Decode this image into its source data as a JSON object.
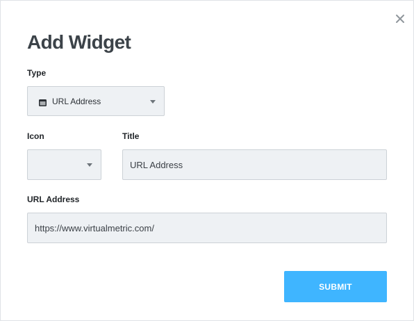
{
  "dialog": {
    "title": "Add Widget",
    "close_icon": "close-icon"
  },
  "form": {
    "type": {
      "label": "Type",
      "selected": "URL Address",
      "selected_icon": "widget-window-icon"
    },
    "icon": {
      "label": "Icon",
      "selected": ""
    },
    "title": {
      "label": "Title",
      "value": "URL Address"
    },
    "url": {
      "label": "URL Address",
      "value": "https://www.virtualmetric.com/"
    }
  },
  "actions": {
    "submit_label": "SUBMIT"
  },
  "colors": {
    "accent": "#3fb5ff",
    "field_background": "#eef1f4",
    "field_border": "#ccd1d6",
    "title_text": "#3c4349"
  }
}
